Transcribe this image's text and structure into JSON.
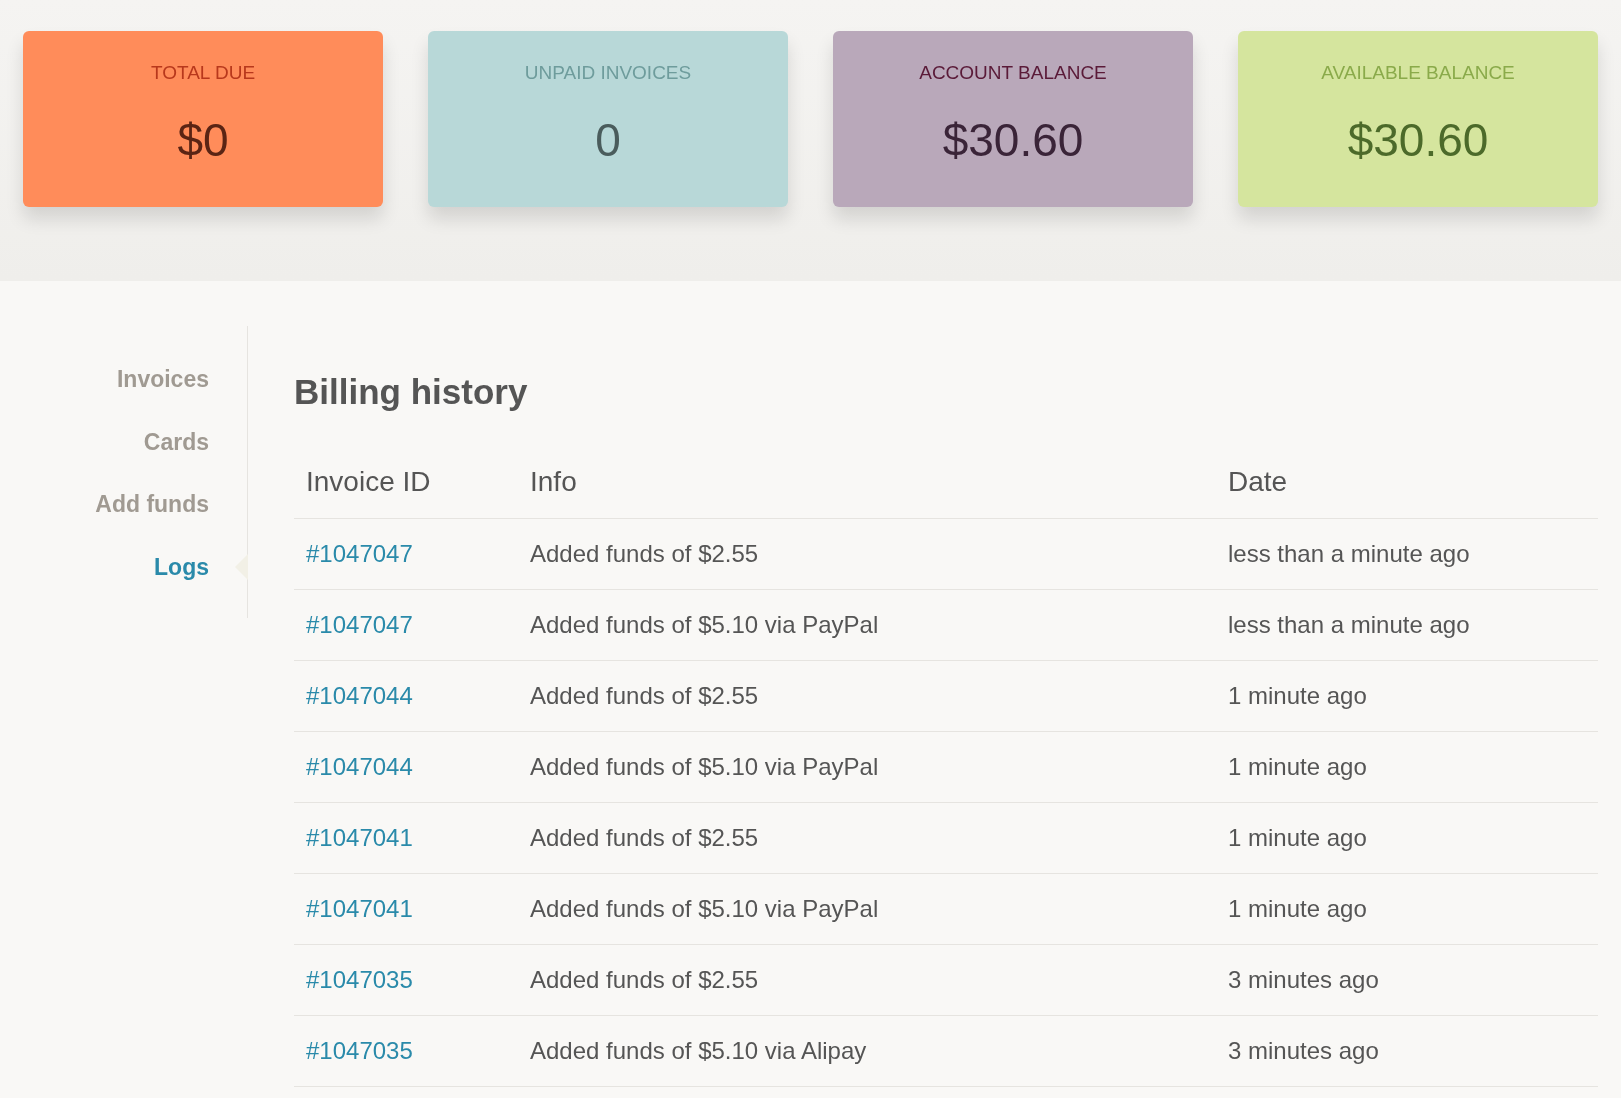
{
  "summary_cards": [
    {
      "label": "TOTAL DUE",
      "value": "$0",
      "color": "#ff8c5a"
    },
    {
      "label": "UNPAID INVOICES",
      "value": "0",
      "color": "#b8d8d8"
    },
    {
      "label": "ACCOUNT BALANCE",
      "value": "$30.60",
      "color": "#b9a8ba"
    },
    {
      "label": "AVAILABLE BALANCE",
      "value": "$30.60",
      "color": "#d5e59e"
    }
  ],
  "sidebar": {
    "items": [
      {
        "label": "Invoices",
        "selected": false
      },
      {
        "label": "Cards",
        "selected": false
      },
      {
        "label": "Add funds",
        "selected": false
      },
      {
        "label": "Logs",
        "selected": true
      }
    ]
  },
  "billing_history": {
    "title": "Billing history",
    "columns": [
      "Invoice ID",
      "Info",
      "Date"
    ],
    "rows": [
      [
        "#1047047",
        "Added funds of $2.55",
        "less than a minute ago"
      ],
      [
        "#1047047",
        "Added funds of $5.10 via PayPal",
        "less than a minute ago"
      ],
      [
        "#1047044",
        "Added funds of $2.55",
        "1 minute ago"
      ],
      [
        "#1047044",
        "Added funds of $5.10 via PayPal",
        "1 minute ago"
      ],
      [
        "#1047041",
        "Added funds of $2.55",
        "1 minute ago"
      ],
      [
        "#1047041",
        "Added funds of $5.10 via PayPal",
        "1 minute ago"
      ],
      [
        "#1047035",
        "Added funds of $2.55",
        "3 minutes ago"
      ],
      [
        "#1047035",
        "Added funds of $5.10 via Alipay",
        "3 minutes ago"
      ]
    ]
  }
}
